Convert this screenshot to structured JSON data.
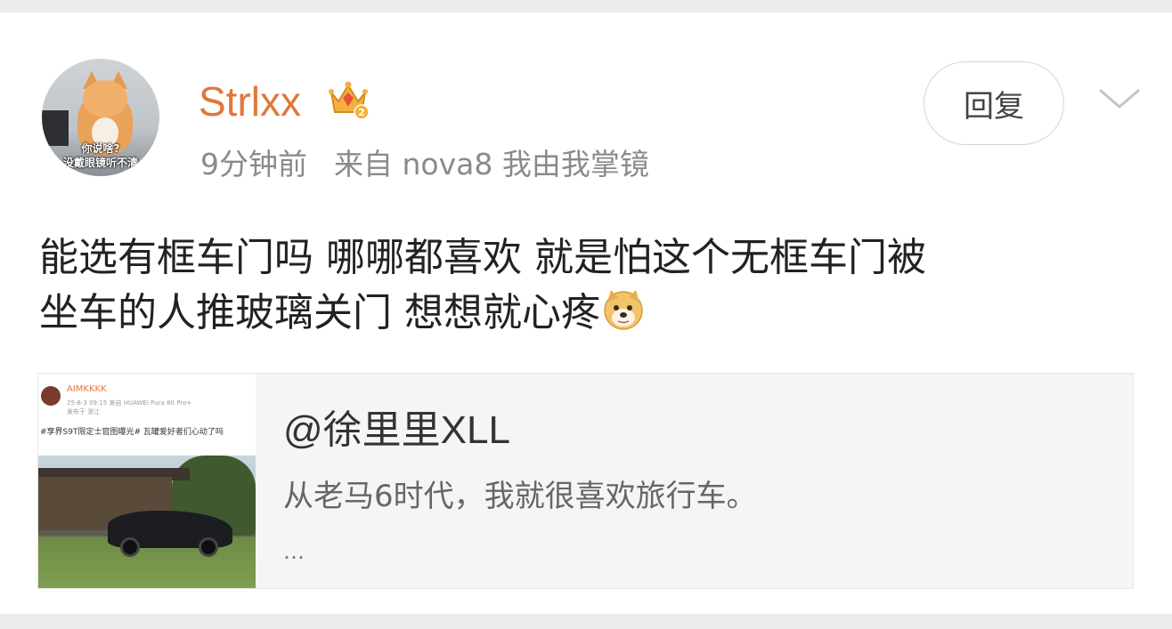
{
  "post": {
    "author": {
      "username": "Strlxx",
      "avatar_caption_1": "你说啥?",
      "avatar_caption_2": "没戴眼镜听不清",
      "badge_icon": "vip-crown-badge-icon",
      "badge_level": "2"
    },
    "timestamp": "9分钟前",
    "source": "来自 nova8 我由我掌镜",
    "reply_label": "回复",
    "menu_icon": "chevron-down-icon",
    "content_line_1": "能选有框车门吗 哪哪都喜欢 就是怕这个无框车门被",
    "content_line_2": "坐车的人推玻璃关门 想想就心疼",
    "content_emoji": "doge-emoji-icon"
  },
  "repost": {
    "author": "@徐里里XLL",
    "text": "从老马6时代，我就很喜欢旅行车。",
    "more": "…",
    "thumbnail": {
      "mini_author": "AIMKKKK",
      "mini_meta": "25-8-3 09:15 来自 HUAWEI Pura 80 Pro+",
      "mini_location": "发布于 浙江",
      "mini_text": "#享界S9T限定士官图曝光# 瓦罐爱好者们心动了吗"
    }
  },
  "colors": {
    "username": "#e3763a",
    "meta_text": "#8a8a8a",
    "body_text": "#222222",
    "repost_bg": "#f5f5f5",
    "page_bg": "#ececec"
  }
}
